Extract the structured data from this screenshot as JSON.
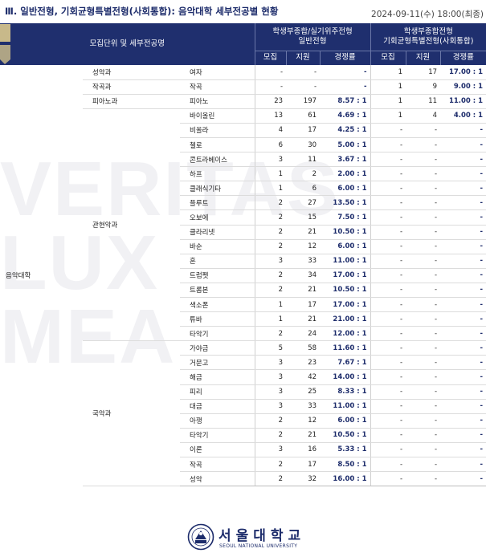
{
  "header": {
    "title": "Ⅲ. 일반전형, 기회균형특별전형(사회통합): 음악대학 세부전공별 현황",
    "date": "2024-09-11(수) 18:00(최종)"
  },
  "watermark": {
    "lines": [
      "VERITAS",
      "LUX",
      "MEA"
    ]
  },
  "table": {
    "unit_header": "모집단위 및 세부전공명",
    "group1_header": [
      "학생부종합/실기위주전형",
      "일반전형"
    ],
    "group2_header": [
      "학생부종합전형",
      "기회균형특별전형(사회통합)"
    ],
    "sub_headers": [
      "모집",
      "지원",
      "경쟁률",
      "모집",
      "지원",
      "경쟁률"
    ],
    "college": "음악대학",
    "dept_instrumental": "관현악과",
    "dept_korean": "국악과",
    "rows": [
      {
        "dept": "성악과",
        "major": "여자",
        "g1": [
          "-",
          "-",
          "-"
        ],
        "g2": [
          "1",
          "17",
          "17.00 : 1"
        ]
      },
      {
        "dept": "작곡과",
        "major": "작곡",
        "g1": [
          "-",
          "-",
          "-"
        ],
        "g2": [
          "1",
          "9",
          "9.00 : 1"
        ]
      },
      {
        "dept": "피아노과",
        "major": "피아노",
        "g1": [
          "23",
          "197",
          "8.57 : 1"
        ],
        "g2": [
          "1",
          "11",
          "11.00 : 1"
        ]
      },
      {
        "dept": "",
        "major": "바이올린",
        "g1": [
          "13",
          "61",
          "4.69 : 1"
        ],
        "g2": [
          "1",
          "4",
          "4.00 : 1"
        ]
      },
      {
        "dept": "",
        "major": "비올라",
        "g1": [
          "4",
          "17",
          "4.25 : 1"
        ],
        "g2": [
          "-",
          "-",
          "-"
        ]
      },
      {
        "dept": "",
        "major": "첼로",
        "g1": [
          "6",
          "30",
          "5.00 : 1"
        ],
        "g2": [
          "-",
          "-",
          "-"
        ]
      },
      {
        "dept": "",
        "major": "콘트라베이스",
        "g1": [
          "3",
          "11",
          "3.67 : 1"
        ],
        "g2": [
          "-",
          "-",
          "-"
        ]
      },
      {
        "dept": "",
        "major": "하프",
        "g1": [
          "1",
          "2",
          "2.00 : 1"
        ],
        "g2": [
          "-",
          "-",
          "-"
        ]
      },
      {
        "dept": "",
        "major": "클래식기타",
        "g1": [
          "1",
          "6",
          "6.00 : 1"
        ],
        "g2": [
          "-",
          "-",
          "-"
        ]
      },
      {
        "dept": "",
        "major": "플루트",
        "g1": [
          "2",
          "27",
          "13.50 : 1"
        ],
        "g2": [
          "-",
          "-",
          "-"
        ]
      },
      {
        "dept": "",
        "major": "오보에",
        "g1": [
          "2",
          "15",
          "7.50 : 1"
        ],
        "g2": [
          "-",
          "-",
          "-"
        ]
      },
      {
        "dept": "",
        "major": "클라리넷",
        "g1": [
          "2",
          "21",
          "10.50 : 1"
        ],
        "g2": [
          "-",
          "-",
          "-"
        ]
      },
      {
        "dept": "",
        "major": "바순",
        "g1": [
          "2",
          "12",
          "6.00 : 1"
        ],
        "g2": [
          "-",
          "-",
          "-"
        ]
      },
      {
        "dept": "",
        "major": "혼",
        "g1": [
          "3",
          "33",
          "11.00 : 1"
        ],
        "g2": [
          "-",
          "-",
          "-"
        ]
      },
      {
        "dept": "",
        "major": "트럼펫",
        "g1": [
          "2",
          "34",
          "17.00 : 1"
        ],
        "g2": [
          "-",
          "-",
          "-"
        ]
      },
      {
        "dept": "",
        "major": "트롬본",
        "g1": [
          "2",
          "21",
          "10.50 : 1"
        ],
        "g2": [
          "-",
          "-",
          "-"
        ]
      },
      {
        "dept": "",
        "major": "색소폰",
        "g1": [
          "1",
          "17",
          "17.00 : 1"
        ],
        "g2": [
          "-",
          "-",
          "-"
        ]
      },
      {
        "dept": "",
        "major": "튜바",
        "g1": [
          "1",
          "21",
          "21.00 : 1"
        ],
        "g2": [
          "-",
          "-",
          "-"
        ]
      },
      {
        "dept": "",
        "major": "타악기",
        "g1": [
          "2",
          "24",
          "12.00 : 1"
        ],
        "g2": [
          "-",
          "-",
          "-"
        ]
      },
      {
        "dept": "",
        "major": "가야금",
        "g1": [
          "5",
          "58",
          "11.60 : 1"
        ],
        "g2": [
          "-",
          "-",
          "-"
        ]
      },
      {
        "dept": "",
        "major": "거문고",
        "g1": [
          "3",
          "23",
          "7.67 : 1"
        ],
        "g2": [
          "-",
          "-",
          "-"
        ]
      },
      {
        "dept": "",
        "major": "해금",
        "g1": [
          "3",
          "42",
          "14.00 : 1"
        ],
        "g2": [
          "-",
          "-",
          "-"
        ]
      },
      {
        "dept": "",
        "major": "피리",
        "g1": [
          "3",
          "25",
          "8.33 : 1"
        ],
        "g2": [
          "-",
          "-",
          "-"
        ]
      },
      {
        "dept": "",
        "major": "대금",
        "g1": [
          "3",
          "33",
          "11.00 : 1"
        ],
        "g2": [
          "-",
          "-",
          "-"
        ]
      },
      {
        "dept": "",
        "major": "아쟁",
        "g1": [
          "2",
          "12",
          "6.00 : 1"
        ],
        "g2": [
          "-",
          "-",
          "-"
        ]
      },
      {
        "dept": "",
        "major": "타악기",
        "g1": [
          "2",
          "21",
          "10.50 : 1"
        ],
        "g2": [
          "-",
          "-",
          "-"
        ]
      },
      {
        "dept": "",
        "major": "이론",
        "g1": [
          "3",
          "16",
          "5.33 : 1"
        ],
        "g2": [
          "-",
          "-",
          "-"
        ]
      },
      {
        "dept": "",
        "major": "작곡",
        "g1": [
          "2",
          "17",
          "8.50 : 1"
        ],
        "g2": [
          "-",
          "-",
          "-"
        ]
      },
      {
        "dept": "",
        "major": "성악",
        "g1": [
          "2",
          "32",
          "16.00 : 1"
        ],
        "g2": [
          "-",
          "-",
          "-"
        ]
      }
    ]
  },
  "footer": {
    "univ_name": "서울대학교",
    "univ_en": "SEOUL NATIONAL UNIVERSITY"
  },
  "colors": {
    "header_navy": "#1f2f6e",
    "accent_gold": "#c8b98a",
    "ratio_text": "#1d2c6b"
  }
}
